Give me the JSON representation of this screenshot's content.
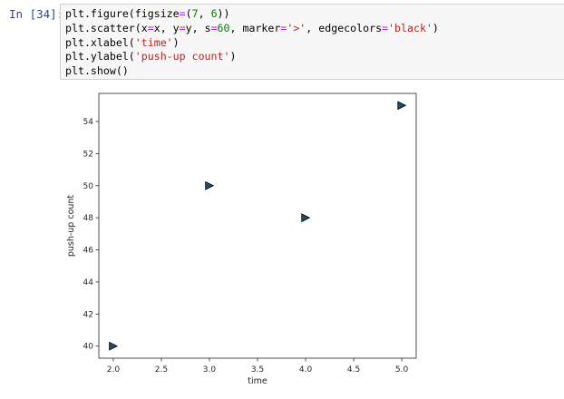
{
  "cell": {
    "prompt": "In [34]:",
    "code_lines": [
      [
        {
          "t": "plt.figure(figsize"
        },
        {
          "t": "=",
          "c": "op"
        },
        {
          "t": "("
        },
        {
          "t": "7",
          "c": "num"
        },
        {
          "t": ", "
        },
        {
          "t": "6",
          "c": "num"
        },
        {
          "t": "))"
        }
      ],
      [
        {
          "t": "plt.scatter(x"
        },
        {
          "t": "=",
          "c": "op"
        },
        {
          "t": "x, y"
        },
        {
          "t": "=",
          "c": "op"
        },
        {
          "t": "y, s"
        },
        {
          "t": "=",
          "c": "op"
        },
        {
          "t": "60",
          "c": "num"
        },
        {
          "t": ", marker"
        },
        {
          "t": "=",
          "c": "op"
        },
        {
          "t": "'>'",
          "c": "str"
        },
        {
          "t": ", edgecolors"
        },
        {
          "t": "=",
          "c": "op"
        },
        {
          "t": "'black'",
          "c": "str"
        },
        {
          "t": ")"
        }
      ],
      [
        {
          "t": "plt.xlabel("
        },
        {
          "t": "'time'",
          "c": "str"
        },
        {
          "t": ")"
        }
      ],
      [
        {
          "t": "plt.ylabel("
        },
        {
          "t": "'push-up count'",
          "c": "str"
        },
        {
          "t": ")"
        }
      ],
      [
        {
          "t": "plt.show()"
        }
      ]
    ]
  },
  "chart_data": {
    "type": "scatter",
    "x": [
      2.0,
      3.0,
      4.0,
      5.0
    ],
    "y": [
      40,
      50,
      48,
      55
    ],
    "xlabel": "time",
    "ylabel": "push-up count",
    "xlim": [
      1.85,
      5.15
    ],
    "ylim": [
      39.25,
      55.75
    ],
    "xticks": [
      2.0,
      2.5,
      3.0,
      3.5,
      4.0,
      4.5,
      5.0
    ],
    "xtick_labels": [
      "2.0",
      "2.5",
      "3.0",
      "3.5",
      "4.0",
      "4.5",
      "5.0"
    ],
    "yticks": [
      40,
      42,
      44,
      46,
      48,
      50,
      52,
      54
    ],
    "ytick_labels": [
      "40",
      "42",
      "44",
      "46",
      "48",
      "50",
      "52",
      "54"
    ],
    "marker": ">",
    "marker_face_color": "#1f4e6b",
    "marker_edge_color": "#000000",
    "grid": false
  }
}
